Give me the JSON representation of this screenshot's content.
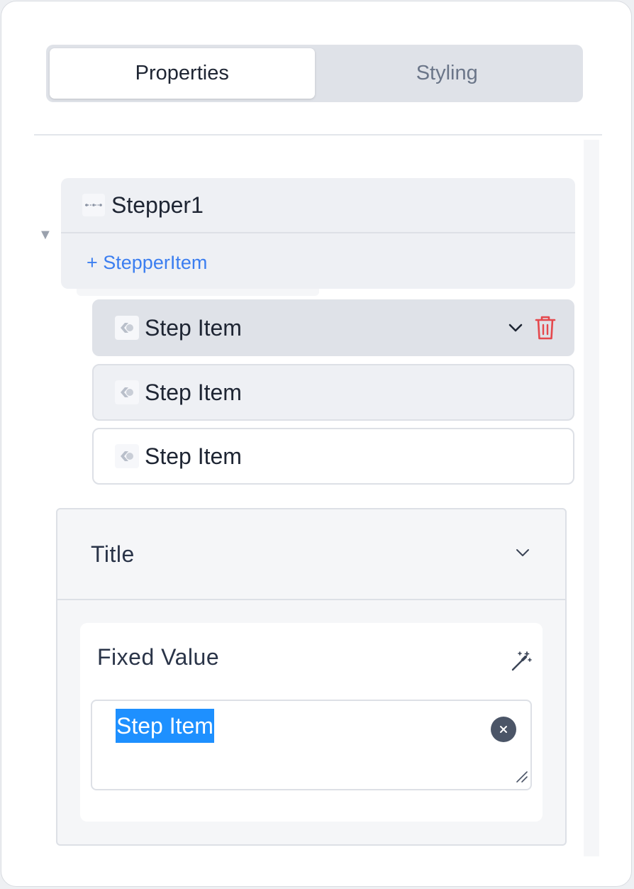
{
  "tabs": [
    {
      "label": "Properties",
      "active": true
    },
    {
      "label": "Styling",
      "active": false
    }
  ],
  "tree": {
    "parent": {
      "title": "Stepper1",
      "icon": "stepper-icon",
      "add_label": "+ StepperItem"
    },
    "items": [
      {
        "label": "Step Item",
        "icon": "step-item-icon",
        "selected": true
      },
      {
        "label": "Step Item",
        "icon": "step-item-icon",
        "selected": false
      },
      {
        "label": "Step Item",
        "icon": "step-item-icon",
        "selected": false
      }
    ]
  },
  "section": {
    "title": "Title",
    "field_label": "Fixed Value",
    "value": "Step Item"
  },
  "colors": {
    "accent": "#3b7ef0",
    "danger": "#e5484d",
    "selection": "#1e90ff"
  }
}
